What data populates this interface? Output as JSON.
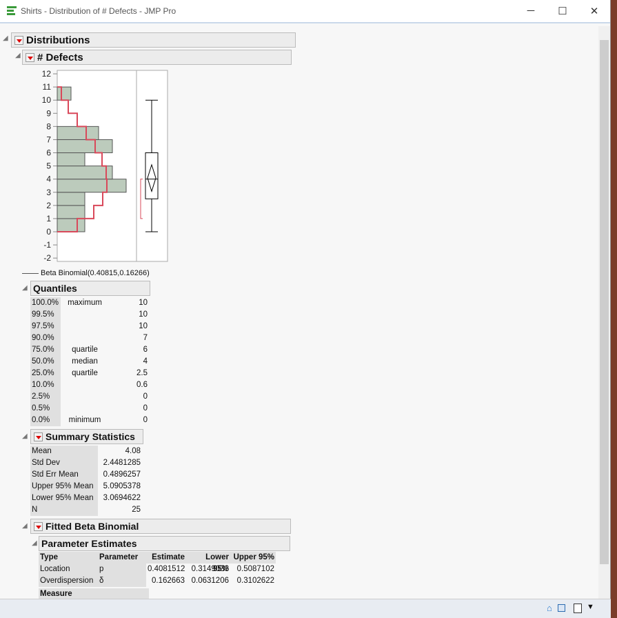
{
  "window": {
    "title": "Shirts - Distribution of # Defects - JMP Pro",
    "minimize": "─",
    "maximize": "☐",
    "close": "✕"
  },
  "distributions": {
    "title": "Distributions"
  },
  "variable": {
    "title": "# Defects"
  },
  "chart_data": {
    "type": "bar",
    "orientation": "horizontal",
    "variable": "# Defects",
    "bins": [
      [
        0,
        1
      ],
      [
        1,
        2
      ],
      [
        2,
        3
      ],
      [
        3,
        4
      ],
      [
        4,
        5
      ],
      [
        5,
        6
      ],
      [
        6,
        7
      ],
      [
        7,
        8
      ],
      [
        8,
        9
      ],
      [
        9,
        10
      ],
      [
        10,
        11
      ]
    ],
    "counts": [
      2,
      2,
      2,
      5,
      4,
      2,
      4,
      3,
      0,
      0,
      1
    ],
    "fitted_density": [
      1.45,
      2.65,
      3.3,
      3.6,
      3.55,
      3.25,
      2.75,
      2.1,
      1.45,
      0.8,
      0.3
    ],
    "yticks": [
      "12",
      "11",
      "10",
      "9",
      "8",
      "7",
      "6",
      "5",
      "4",
      "3",
      "2",
      "1",
      "0",
      "-1",
      "-2"
    ],
    "ylim": [
      -2,
      12
    ],
    "boxplot": {
      "min": 0,
      "q1": 2.5,
      "median": 4,
      "q3": 6,
      "max": 10,
      "mean": 4.08,
      "mean_ci": [
        3.0694622,
        5.0905378
      ],
      "shortest_half": [
        1,
        4
      ]
    },
    "legend": "Beta Binomial(0.40815,0.16266)",
    "colors": {
      "bar": "#bccbbc",
      "fit": "#d9485a",
      "shortest_half": "#d9485a"
    }
  },
  "quantiles": {
    "title": "Quantiles",
    "rows": [
      [
        "100.0%",
        "maximum",
        "10"
      ],
      [
        "99.5%",
        "",
        "10"
      ],
      [
        "97.5%",
        "",
        "10"
      ],
      [
        "90.0%",
        "",
        "7"
      ],
      [
        "75.0%",
        "quartile",
        "6"
      ],
      [
        "50.0%",
        "median",
        "4"
      ],
      [
        "25.0%",
        "quartile",
        "2.5"
      ],
      [
        "10.0%",
        "",
        "0.6"
      ],
      [
        "2.5%",
        "",
        "0"
      ],
      [
        "0.5%",
        "",
        "0"
      ],
      [
        "0.0%",
        "minimum",
        "0"
      ]
    ]
  },
  "summary": {
    "title": "Summary Statistics",
    "rows": [
      [
        "Mean",
        "4.08"
      ],
      [
        "Std Dev",
        "2.4481285"
      ],
      [
        "Std Err Mean",
        "0.4896257"
      ],
      [
        "Upper 95% Mean",
        "5.0905378"
      ],
      [
        "Lower 95% Mean",
        "3.0694622"
      ],
      [
        "N",
        "25"
      ]
    ]
  },
  "fitted": {
    "title": "Fitted Beta Binomial",
    "param_title": "Parameter Estimates",
    "headers": [
      "Type",
      "Parameter",
      "Estimate",
      "Lower 95%",
      "Upper 95%"
    ],
    "rows": [
      [
        "Location",
        "p",
        "0.4081512",
        "0.3149033",
        "0.5087102"
      ],
      [
        "Overdispersion",
        "δ",
        "0.162663",
        "0.0631206",
        "0.3102622"
      ]
    ],
    "measure": "Measure"
  }
}
